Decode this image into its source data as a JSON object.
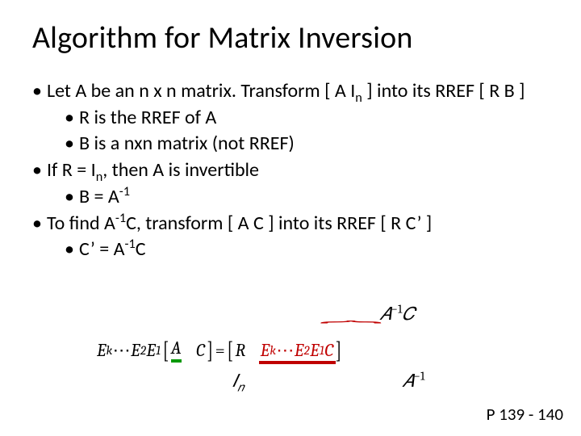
{
  "title": "Algorithm for Matrix Inversion",
  "bullets": {
    "b1": "Let A be an n x n matrix. Transform [ A I",
    "b1_sub": "n",
    "b1_tail": " ] into its RREF [ R B ]",
    "b1a": "R is the RREF of A",
    "b1b": "B is a nxn matrix (not RREF)",
    "b2": "If R = I",
    "b2_sub": "n",
    "b2_tail": ", then A is invertible",
    "b2a_pre": "B = A",
    "b2a_sup": "-1",
    "b3_pre": "To find A",
    "b3_sup": "-1",
    "b3_mid": "C, transform [ A C ] into its RREF [ R C’ ]",
    "b3a_pre": "C’ = A",
    "b3a_sup": "-1",
    "b3a_tail": "C"
  },
  "equation": {
    "Ek": "E",
    "k": "k",
    "dots": " ⋯ ",
    "E2": "E",
    "two": "2",
    "E1": "E",
    "one": "1",
    "A": "A",
    "C": "C",
    "eq": " = ",
    "R": "R",
    "AinvC": "A⁻¹C",
    "In": "Iₙ",
    "Ainv": "A⁻¹"
  },
  "pageref": "P 139 - 140"
}
